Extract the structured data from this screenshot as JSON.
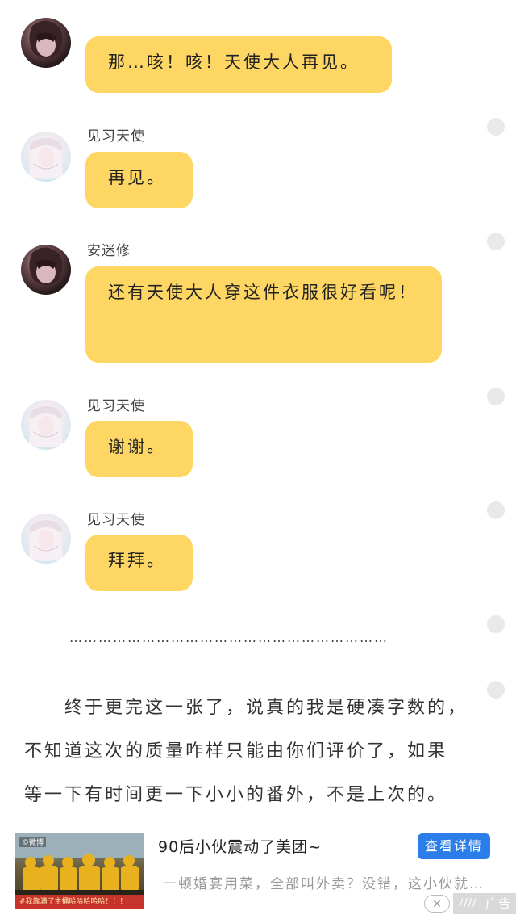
{
  "messages": [
    {
      "speaker": "安迷修",
      "text": "那…咳！咳！天使大人再见。"
    },
    {
      "speaker": "见习天使",
      "text": "再见。"
    },
    {
      "speaker": "安迷修",
      "text": "还有天使大人穿这件衣服很好看呢！"
    },
    {
      "speaker": "见习天使",
      "text": "谢谢。"
    },
    {
      "speaker": "见习天使",
      "text": "拜拜。"
    }
  ],
  "bubble_color": "#fdd663",
  "divider": "…………………………………………………………",
  "author_note": [
    "终于更完这一张了，说真的我是硬凑字数的，",
    "不知道这次的质量咋样只能由你们评价了，如果",
    "等一下有时间更一下小小的番外，不是上次的。"
  ],
  "ad": {
    "title": "90后小伙震动了美团~",
    "button": "查看详情",
    "description": "一顿婚宴用菜，全部叫外卖？没错，这小伙就…",
    "close": "✕",
    "label": "广告",
    "thumb_tag": "©微博",
    "thumb_caption": "#我靠满了主播哈哈哈哈哈！！！",
    "button_color": "#2b7de9"
  }
}
